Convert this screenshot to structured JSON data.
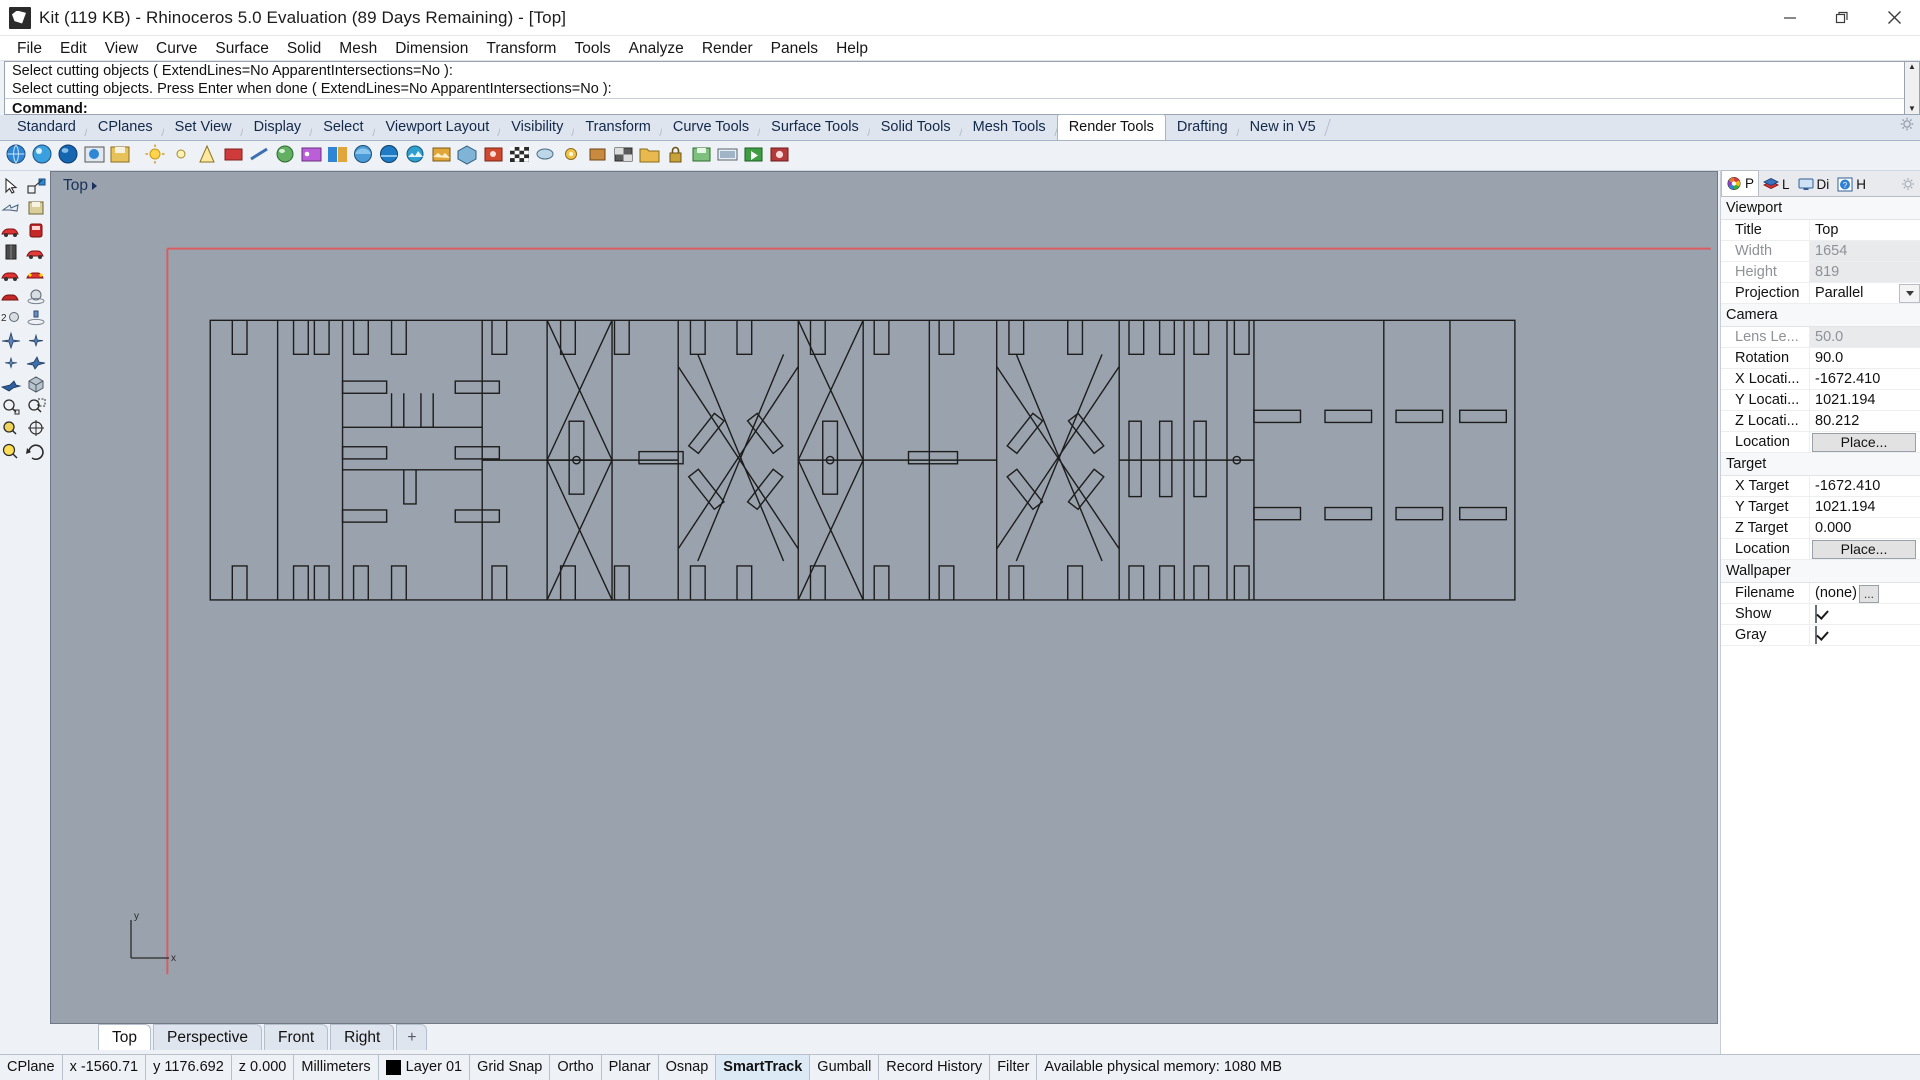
{
  "window": {
    "title": "Kit (119 KB) - Rhinoceros 5.0 Evaluation (89 Days Remaining) - [Top]",
    "icon": "rhino-logo-icon",
    "controls": {
      "minimize": "minimize-icon",
      "maximize": "restore-icon",
      "close": "close-icon"
    }
  },
  "menubar": {
    "items": [
      "File",
      "Edit",
      "View",
      "Curve",
      "Surface",
      "Solid",
      "Mesh",
      "Dimension",
      "Transform",
      "Tools",
      "Analyze",
      "Render",
      "Panels",
      "Help"
    ]
  },
  "command_area": {
    "history": [
      "Select cutting objects ( ExtendLines=No  ApparentIntersections=No ):",
      "Select cutting objects. Press Enter when done ( ExtendLines=No  ApparentIntersections=No ):"
    ],
    "prompt": "Command:",
    "input_value": ""
  },
  "toolbar_tabs": {
    "items": [
      "Standard",
      "CPlanes",
      "Set View",
      "Display",
      "Select",
      "Viewport Layout",
      "Visibility",
      "Transform",
      "Curve Tools",
      "Surface Tools",
      "Solid Tools",
      "Mesh Tools",
      "Render Tools",
      "Drafting",
      "New in V5"
    ],
    "active": "Render Tools",
    "options_icon": "gear-icon"
  },
  "icon_toolbar": {
    "icons": [
      "render-globe-icon",
      "render-preview-icon",
      "render-blue-sphere-icon",
      "render-window-icon",
      "save-render-icon",
      "sun-light-icon",
      "point-light-icon",
      "spot-light-icon",
      "rectangular-light-icon",
      "linear-light-icon",
      "material-editor-icon",
      "texture-palette-icon",
      "assign-material-icon",
      "material-sphere-icon",
      "environment-icon",
      "bitmap-texture-icon",
      "texture-map-icon",
      "render-mesh-icon",
      "render-settings-icon",
      "ground-plane-icon",
      "skylight-icon",
      "decal-icon",
      "render-color-icon",
      "checkerboard-icon",
      "ellipse-shade-icon",
      "bulb-icon",
      "lock-render-icon",
      "open-folder-icon",
      "save-image-icon",
      "film-frame-icon",
      "play-animation-icon",
      "record-animation-icon"
    ]
  },
  "left_toolbar": {
    "icons": [
      "select-arrow-icon",
      "select-window-icon",
      "select-previous-icon",
      "save-car-icon",
      "select-red-car-icon",
      "select-front-car-icon",
      "select-block-icon",
      "select-last-car-icon",
      "select-visible-icon",
      "select-highlight-icon",
      "select-object-icon",
      "select-sphere-icon",
      "select-duplicate-icon",
      "select-lighting-icon",
      "select-plane-icon",
      "select-star-icon",
      "select-star-alt-icon",
      "select-plane-blue-icon",
      "select-plane-fly-icon",
      "select-box-icon",
      "zoom-window-icon",
      "zoom-dashed-icon",
      "zoom-selected-icon",
      "zoom-target-icon",
      "zoom-extents-icon",
      "zoom-previous-icon"
    ]
  },
  "viewport": {
    "label": "Top",
    "caret_icon": "viewport-menu-caret-icon",
    "cplane_axes": {
      "x_label": "x",
      "y_label": "y"
    },
    "background_color": "#9aa3ad",
    "line_color": "#1d1d1d",
    "cplane_line_color": "#d95c63"
  },
  "viewport_tabs": {
    "items": [
      "Top",
      "Perspective",
      "Front",
      "Right"
    ],
    "active": "Top",
    "add_label": "+"
  },
  "right_panel": {
    "tabs": [
      {
        "label": "P",
        "icon": "properties-colorwheel-icon",
        "active": true
      },
      {
        "label": "L",
        "icon": "layers-icon",
        "active": false
      },
      {
        "label": "Di",
        "icon": "display-monitor-icon",
        "active": false
      },
      {
        "label": "H",
        "icon": "help-icon",
        "active": false
      }
    ],
    "gear_icon": "panel-options-gear-icon",
    "sections": [
      {
        "title": "Viewport",
        "rows": [
          {
            "label": "Title",
            "value": "Top",
            "type": "text",
            "readonly": false
          },
          {
            "label": "Width",
            "value": "1654",
            "type": "text",
            "readonly": true
          },
          {
            "label": "Height",
            "value": "819",
            "type": "text",
            "readonly": true
          },
          {
            "label": "Projection",
            "value": "Parallel",
            "type": "combo",
            "readonly": false
          }
        ]
      },
      {
        "title": "Camera",
        "rows": [
          {
            "label": "Lens Le...",
            "value": "50.0",
            "type": "text",
            "readonly": true
          },
          {
            "label": "Rotation",
            "value": "90.0",
            "type": "text",
            "readonly": false
          },
          {
            "label": "X Locati...",
            "value": "-1672.410",
            "type": "text",
            "readonly": false
          },
          {
            "label": "Y Locati...",
            "value": "1021.194",
            "type": "text",
            "readonly": false
          },
          {
            "label": "Z Locati...",
            "value": "80.212",
            "type": "text",
            "readonly": false
          },
          {
            "label": "Location",
            "value": "Place...",
            "type": "button",
            "readonly": false
          }
        ]
      },
      {
        "title": "Target",
        "rows": [
          {
            "label": "X Target",
            "value": "-1672.410",
            "type": "text",
            "readonly": false
          },
          {
            "label": "Y Target",
            "value": "1021.194",
            "type": "text",
            "readonly": false
          },
          {
            "label": "Z Target",
            "value": "0.000",
            "type": "text",
            "readonly": false
          },
          {
            "label": "Location",
            "value": "Place...",
            "type": "button",
            "readonly": false
          }
        ]
      },
      {
        "title": "Wallpaper",
        "rows": [
          {
            "label": "Filename",
            "value": "(none)",
            "type": "file",
            "button": "...",
            "readonly": false
          },
          {
            "label": "Show",
            "value": "",
            "type": "checkbox",
            "checked": true,
            "readonly": false
          },
          {
            "label": "Gray",
            "value": "",
            "type": "checkbox",
            "checked": true,
            "readonly": false
          }
        ]
      }
    ]
  },
  "statusbar": {
    "cplane_label": "CPlane",
    "x": "x -1560.71",
    "y": "y 1176.692",
    "z": "z 0.000",
    "units": "Millimeters",
    "layer": "Layer 01",
    "layer_color": "#000000",
    "toggles": [
      {
        "label": "Grid Snap",
        "on": false
      },
      {
        "label": "Ortho",
        "on": false
      },
      {
        "label": "Planar",
        "on": false
      },
      {
        "label": "Osnap",
        "on": false
      },
      {
        "label": "SmartTrack",
        "on": true
      },
      {
        "label": "Gumball",
        "on": false
      },
      {
        "label": "Record History",
        "on": false
      },
      {
        "label": "Filter",
        "on": false
      }
    ],
    "memory": "Available physical memory: 1080 MB"
  }
}
